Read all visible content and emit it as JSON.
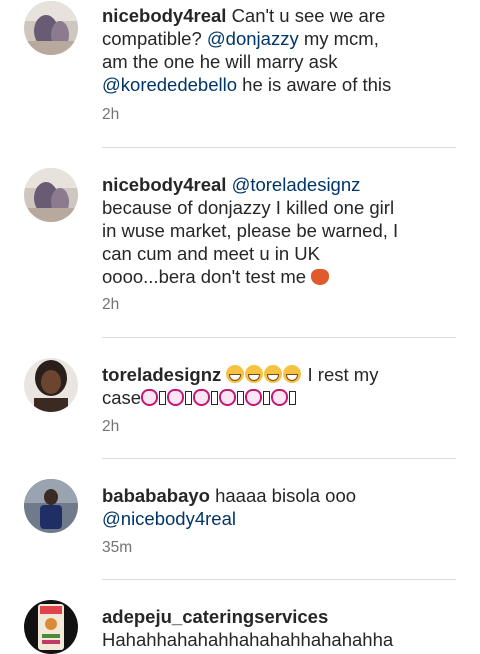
{
  "comments": [
    {
      "username": "nicebody4real",
      "lines": [
        [
          "Can't u see we are"
        ],
        [
          "compatible? ",
          "@donjazzy",
          " my mcm,"
        ],
        [
          "am the one he will marry ask"
        ],
        [
          "@korededebello",
          " he is aware of this"
        ]
      ],
      "time": "2h",
      "avatar_icon": "avatar-photo-icon"
    },
    {
      "username": "nicebody4real",
      "mention": "@toreladesignz",
      "lines": [
        "because of donjazzy I killed one girl",
        "in wuse market, please be warned, I",
        "can cum and meet u in UK",
        "oooo...bera don't test me"
      ],
      "trailing_emoji": "devil-face-icon",
      "time": "2h",
      "avatar_icon": "avatar-photo-icon"
    },
    {
      "username": "toreladesignz",
      "emoji_after_username": "grinning-face-icon",
      "emoji_count": 4,
      "text": "I rest my",
      "second_line_text": "case",
      "clap_emoji": "clapping-hands-icon",
      "clap_count": 6,
      "time": "2h",
      "avatar_icon": "avatar-photo-icon"
    },
    {
      "username": "babababayo",
      "text": "haaaa bisola ooo",
      "mention": "@nicebody4real",
      "time": "35m",
      "avatar_icon": "avatar-photo-icon"
    },
    {
      "username": "adepeju_cateringservices",
      "text": "Hahahhahahahhahahahhahahahha",
      "avatar_icon": "avatar-photo-icon"
    }
  ],
  "colors": {
    "text": "#262626",
    "mention": "#003569",
    "meta": "#737373",
    "divider": "#dbdbdb"
  }
}
